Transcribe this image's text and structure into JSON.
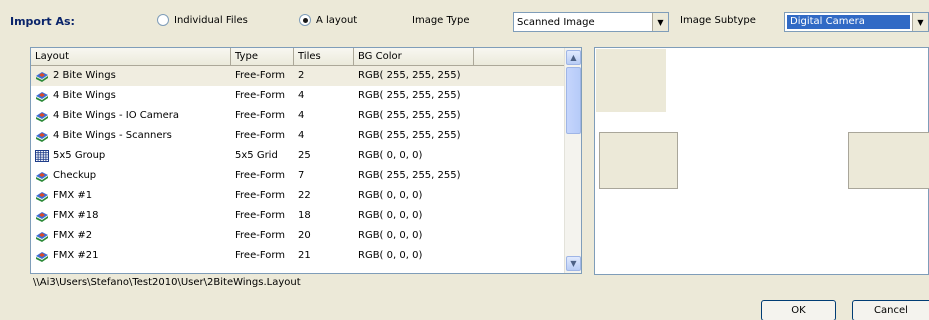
{
  "top": {
    "import_label": "Import As:",
    "radio_individual": "Individual Files",
    "radio_layout": "A layout",
    "image_type_label": "Image Type",
    "image_type_value": "Scanned Image",
    "image_subtype_label": "Image Subtype",
    "image_subtype_value": "Digital Camera",
    "selected_radio": "A layout"
  },
  "list": {
    "columns": [
      "Layout",
      "Type",
      "Tiles",
      "BG Color"
    ],
    "rows": [
      {
        "name": "2 Bite Wings",
        "type": "Free-Form",
        "tiles": "2",
        "bg": "RGB( 255, 255, 255)",
        "icon": "layout-icon"
      },
      {
        "name": "4 Bite Wings",
        "type": "Free-Form",
        "tiles": "4",
        "bg": "RGB( 255, 255, 255)",
        "icon": "layout-icon"
      },
      {
        "name": "4 Bite Wings - IO Camera",
        "type": "Free-Form",
        "tiles": "4",
        "bg": "RGB( 255, 255, 255)",
        "icon": "layout-icon"
      },
      {
        "name": "4 Bite Wings - Scanners",
        "type": "Free-Form",
        "tiles": "4",
        "bg": "RGB( 255, 255, 255)",
        "icon": "layout-icon"
      },
      {
        "name": "5x5 Group",
        "type": "5x5 Grid",
        "tiles": "25",
        "bg": "RGB( 0, 0, 0)",
        "icon": "grid-icon"
      },
      {
        "name": "Checkup",
        "type": "Free-Form",
        "tiles": "7",
        "bg": "RGB( 255, 255, 255)",
        "icon": "layout-icon"
      },
      {
        "name": "FMX #1",
        "type": "Free-Form",
        "tiles": "22",
        "bg": "RGB( 0, 0, 0)",
        "icon": "layout-icon"
      },
      {
        "name": "FMX #18",
        "type": "Free-Form",
        "tiles": "18",
        "bg": "RGB( 0, 0, 0)",
        "icon": "layout-icon"
      },
      {
        "name": "FMX #2",
        "type": "Free-Form",
        "tiles": "20",
        "bg": "RGB( 0, 0, 0)",
        "icon": "layout-icon"
      },
      {
        "name": "FMX #21",
        "type": "Free-Form",
        "tiles": "21",
        "bg": "RGB( 0, 0, 0)",
        "icon": "layout-icon"
      }
    ],
    "selected_index": 0
  },
  "path": "\\\\Ai3\\Users\\Stefano\\Test2010\\User\\2BiteWings.Layout",
  "buttons": {
    "ok": "OK",
    "cancel": "Cancel"
  },
  "colors": {
    "label_blue": "#0a246a",
    "selection_blue": "#316ac5",
    "panel": "#ece9d8"
  }
}
